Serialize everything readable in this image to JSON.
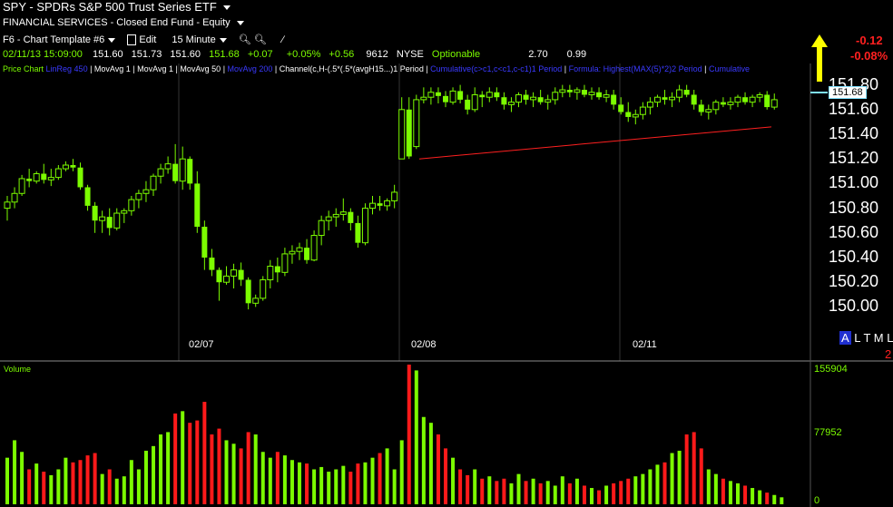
{
  "header": {
    "title": "SPY - SPDRs S&P 500 Trust Series ETF",
    "sector": "FINANCIAL SERVICES - Closed End Fund - Equity",
    "template": "F6 - Chart Template #6",
    "edit": "Edit",
    "interval": "15 Minute"
  },
  "quote": {
    "datetime": "02/11/13 15:09:00",
    "open": "151.60",
    "high": "151.73",
    "low": "151.60",
    "close": "151.68",
    "change": "+0.07",
    "pct_change": "+0.05%",
    "day_change": "+0.56",
    "volume": "9612",
    "exchange": "NYSE",
    "optionable": "Optionable",
    "val1": "2.70",
    "val2": "0.99",
    "change_red": "-0.12",
    "pct_red": "-0.08%"
  },
  "studies": {
    "price_chart": "Price Chart",
    "linreg": "LinReg 450",
    "ma1": "MovAvg 1",
    "ma1b": "MovAvg 1",
    "ma50": "MovAvg 50",
    "ma200": "MovAvg 200",
    "channel": "Channel(c,H-(.5*(.5*(avgH15...)1 Period",
    "cum1": "Cumulative(c>c1,c<c1,c-c1)1 Period",
    "formula": "Formula: Highest(MAX(5)*2)2 Period",
    "cum2": "Cumulative"
  },
  "price_axis": {
    "labels": [
      "151.80",
      "151.60",
      "151.40",
      "151.20",
      "151.00",
      "150.80",
      "150.60",
      "150.40",
      "150.20",
      "150.00"
    ],
    "current": "151.68"
  },
  "date_axis": [
    "02/07",
    "02/08",
    "02/11"
  ],
  "toggles": {
    "a": "A",
    "l": "L",
    "t": "T",
    "m": "M",
    "l2": "L",
    "two": "2"
  },
  "volume": {
    "label": "Volume",
    "top": "155904",
    "mid": "77952",
    "zero": "0"
  },
  "colors": {
    "up": "#7CFC00",
    "down": "#ff1a1a",
    "trend": "#ff2020",
    "arrow": "#ffff00"
  },
  "chart_data": {
    "type": "candlestick",
    "ylim": [
      149.9,
      151.9
    ],
    "candles": [
      [
        150.8,
        150.9,
        150.7,
        150.85
      ],
      [
        150.85,
        150.97,
        150.8,
        150.92
      ],
      [
        150.92,
        151.07,
        150.9,
        151.04
      ],
      [
        151.04,
        151.12,
        150.97,
        151.02
      ],
      [
        151.02,
        151.1,
        151.0,
        151.08
      ],
      [
        151.08,
        151.16,
        151.0,
        151.03
      ],
      [
        151.03,
        151.12,
        150.98,
        151.05
      ],
      [
        151.05,
        151.15,
        151.03,
        151.12
      ],
      [
        151.12,
        151.18,
        151.1,
        151.15
      ],
      [
        151.15,
        151.2,
        151.1,
        151.13
      ],
      [
        151.13,
        151.17,
        150.95,
        150.97
      ],
      [
        150.97,
        150.99,
        150.78,
        150.82
      ],
      [
        150.82,
        150.85,
        150.6,
        150.7
      ],
      [
        150.7,
        150.78,
        150.6,
        150.73
      ],
      [
        150.73,
        150.8,
        150.58,
        150.64
      ],
      [
        150.64,
        150.8,
        150.62,
        150.76
      ],
      [
        150.76,
        150.8,
        150.68,
        150.78
      ],
      [
        150.78,
        150.9,
        150.74,
        150.87
      ],
      [
        150.87,
        150.95,
        150.8,
        150.92
      ],
      [
        150.92,
        151.02,
        150.85,
        150.95
      ],
      [
        150.95,
        151.08,
        150.9,
        151.06
      ],
      [
        151.06,
        151.16,
        151.0,
        151.12
      ],
      [
        151.12,
        151.22,
        151.08,
        151.16
      ],
      [
        151.16,
        151.32,
        151.0,
        151.02
      ],
      [
        151.02,
        151.3,
        150.95,
        151.2
      ],
      [
        151.2,
        151.22,
        150.95,
        151.0
      ],
      [
        151.0,
        151.1,
        150.6,
        150.65
      ],
      [
        150.65,
        150.7,
        150.3,
        150.4
      ],
      [
        150.4,
        150.47,
        150.25,
        150.3
      ],
      [
        150.3,
        150.32,
        150.05,
        150.2
      ],
      [
        150.2,
        150.33,
        150.18,
        150.25
      ],
      [
        150.25,
        150.35,
        150.15,
        150.3
      ],
      [
        150.3,
        150.36,
        150.17,
        150.22
      ],
      [
        150.22,
        150.24,
        149.98,
        150.03
      ],
      [
        150.03,
        150.1,
        150.0,
        150.07
      ],
      [
        150.07,
        150.25,
        150.05,
        150.22
      ],
      [
        150.22,
        150.38,
        150.15,
        150.33
      ],
      [
        150.33,
        150.4,
        150.2,
        150.28
      ],
      [
        150.28,
        150.48,
        150.25,
        150.43
      ],
      [
        150.43,
        150.5,
        150.35,
        150.45
      ],
      [
        150.45,
        150.52,
        150.38,
        150.48
      ],
      [
        150.48,
        150.55,
        150.35,
        150.38
      ],
      [
        150.38,
        150.62,
        150.37,
        150.58
      ],
      [
        150.58,
        150.74,
        150.5,
        150.7
      ],
      [
        150.7,
        150.78,
        150.62,
        150.73
      ],
      [
        150.73,
        150.8,
        150.65,
        150.75
      ],
      [
        150.75,
        150.88,
        150.7,
        150.77
      ],
      [
        150.77,
        150.8,
        150.62,
        150.68
      ],
      [
        150.68,
        150.74,
        150.48,
        150.52
      ],
      [
        150.52,
        150.84,
        150.5,
        150.8
      ],
      [
        150.8,
        150.9,
        150.75,
        150.84
      ],
      [
        150.84,
        150.9,
        150.78,
        150.82
      ],
      [
        150.82,
        150.88,
        150.78,
        150.86
      ],
      [
        150.86,
        150.99,
        150.8,
        150.93
      ],
      [
        151.2,
        151.7,
        151.2,
        151.6
      ],
      [
        151.6,
        151.7,
        151.2,
        151.22
      ],
      [
        151.3,
        151.72,
        151.28,
        151.68
      ],
      [
        151.68,
        151.78,
        151.65,
        151.7
      ],
      [
        151.7,
        151.78,
        151.64,
        151.74
      ],
      [
        151.74,
        151.78,
        151.65,
        151.71
      ],
      [
        151.71,
        151.75,
        151.62,
        151.66
      ],
      [
        151.66,
        151.78,
        151.64,
        151.75
      ],
      [
        151.75,
        151.8,
        151.65,
        151.68
      ],
      [
        151.68,
        151.72,
        151.56,
        151.6
      ],
      [
        151.6,
        151.78,
        151.58,
        151.72
      ],
      [
        151.72,
        151.75,
        151.62,
        151.7
      ],
      [
        151.7,
        151.78,
        151.66,
        151.74
      ],
      [
        151.74,
        151.78,
        151.67,
        151.7
      ],
      [
        151.7,
        151.74,
        151.6,
        151.64
      ],
      [
        151.64,
        151.7,
        151.58,
        151.66
      ],
      [
        151.66,
        151.74,
        151.62,
        151.72
      ],
      [
        151.72,
        151.76,
        151.64,
        151.68
      ],
      [
        151.68,
        151.74,
        151.62,
        151.7
      ],
      [
        151.7,
        151.76,
        151.64,
        151.66
      ],
      [
        151.66,
        151.72,
        151.6,
        151.68
      ],
      [
        151.68,
        151.78,
        151.64,
        151.74
      ],
      [
        151.74,
        151.8,
        151.7,
        151.76
      ],
      [
        151.76,
        151.8,
        151.7,
        151.74
      ],
      [
        151.74,
        151.78,
        151.68,
        151.76
      ],
      [
        151.76,
        151.8,
        151.7,
        151.72
      ],
      [
        151.72,
        151.78,
        151.68,
        151.74
      ],
      [
        151.74,
        151.78,
        151.68,
        151.7
      ],
      [
        151.7,
        151.76,
        151.66,
        151.72
      ],
      [
        151.72,
        151.76,
        151.6,
        151.64
      ],
      [
        151.64,
        151.7,
        151.56,
        151.58
      ],
      [
        151.58,
        151.66,
        151.5,
        151.54
      ],
      [
        151.54,
        151.6,
        151.48,
        151.56
      ],
      [
        151.56,
        151.66,
        151.52,
        151.62
      ],
      [
        151.62,
        151.7,
        151.56,
        151.66
      ],
      [
        151.66,
        151.72,
        151.62,
        151.7
      ],
      [
        151.7,
        151.76,
        151.64,
        151.68
      ],
      [
        151.68,
        151.74,
        151.62,
        151.7
      ],
      [
        151.7,
        151.8,
        151.66,
        151.76
      ],
      [
        151.76,
        151.8,
        151.7,
        151.72
      ],
      [
        151.72,
        151.76,
        151.6,
        151.64
      ],
      [
        151.64,
        151.68,
        151.55,
        151.58
      ],
      [
        151.58,
        151.64,
        151.52,
        151.6
      ],
      [
        151.6,
        151.68,
        151.56,
        151.66
      ],
      [
        151.66,
        151.7,
        151.62,
        151.64
      ],
      [
        151.64,
        151.7,
        151.6,
        151.66
      ],
      [
        151.66,
        151.72,
        151.62,
        151.7
      ],
      [
        151.7,
        151.74,
        151.64,
        151.66
      ],
      [
        151.66,
        151.72,
        151.62,
        151.7
      ],
      [
        151.7,
        151.74,
        151.66,
        151.72
      ],
      [
        151.72,
        151.75,
        151.6,
        151.62
      ],
      [
        151.62,
        151.73,
        151.6,
        151.68
      ]
    ],
    "volumes": [
      40,
      55,
      45,
      30,
      35,
      28,
      25,
      30,
      40,
      36,
      38,
      42,
      44,
      26,
      30,
      22,
      24,
      38,
      30,
      46,
      50,
      60,
      62,
      78,
      80,
      70,
      72,
      88,
      60,
      65,
      55,
      52,
      48,
      62,
      60,
      45,
      40,
      45,
      42,
      38,
      36,
      35,
      30,
      32,
      28,
      30,
      33,
      28,
      35,
      36,
      40,
      44,
      48,
      30,
      55,
      120,
      115,
      75,
      70,
      60,
      48,
      40,
      30,
      25,
      30,
      22,
      24,
      20,
      22,
      18,
      26,
      20,
      22,
      18,
      20,
      16,
      24,
      18,
      22,
      16,
      14,
      12,
      16,
      18,
      20,
      22,
      24,
      26,
      30,
      34,
      36,
      44,
      46,
      60,
      62,
      48,
      30,
      26,
      22,
      20,
      18,
      16,
      14,
      12,
      10,
      8,
      6
    ],
    "trend_line": [
      [
        151.2,
        151.46
      ]
    ]
  }
}
